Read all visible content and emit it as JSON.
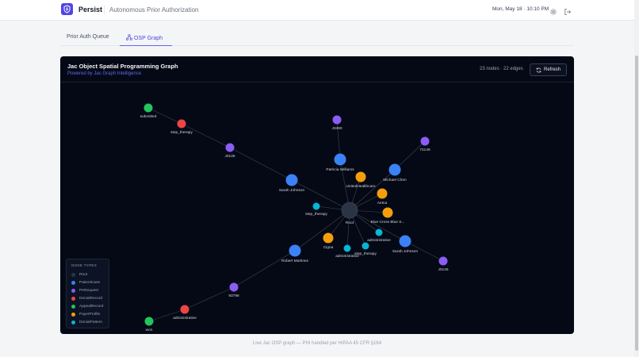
{
  "header": {
    "brand": "Persist",
    "subtitle": "Autonomous Prior Authorization",
    "datetime": "Mon, May 18 · 10:10 PM",
    "icons": [
      "shield-logo-icon",
      "gear-icon",
      "logout-icon"
    ]
  },
  "tabs": [
    {
      "label": "Prior Auth Queue",
      "active": false
    },
    {
      "label": "OSP Graph",
      "active": true,
      "icon": "graph-icon"
    }
  ],
  "panel": {
    "title": "Jac Object Spatial Programming Graph",
    "subtitle": "Powered by Jac Graph Intelligence",
    "stats": "23 nodes · 22 edges",
    "refresh_label": "Refresh"
  },
  "legend": {
    "title": "NODE TYPES",
    "items": [
      {
        "label": "Root",
        "color": "#2b3445"
      },
      {
        "label": "PatientCase",
        "color": "#3b82f6"
      },
      {
        "label": "PARequest",
        "color": "#8b5cf6"
      },
      {
        "label": "DenialRecord",
        "color": "#ef4444"
      },
      {
        "label": "AppealRecord",
        "color": "#22c55e"
      },
      {
        "label": "PayerProfile",
        "color": "#f59e0b"
      },
      {
        "label": "DenialPattern",
        "color": "#06b6d4"
      }
    ]
  },
  "graph": {
    "nodes": [
      {
        "id": "root",
        "label": "Root",
        "type": "Root"
      },
      {
        "id": "n1",
        "label": "submitted",
        "type": "AppealRecord"
      },
      {
        "id": "n2",
        "label": "step_therapy",
        "type": "DenialRecord"
      },
      {
        "id": "n3",
        "label": "J0135",
        "type": "PARequest"
      },
      {
        "id": "n4",
        "label": "Sarah Johnson",
        "type": "PatientCase"
      },
      {
        "id": "n5",
        "label": "J3490",
        "type": "PARequest"
      },
      {
        "id": "n6",
        "label": "Patricia Williams",
        "type": "PatientCase"
      },
      {
        "id": "n7",
        "label": "UnitedHealthcare",
        "type": "PayerProfile"
      },
      {
        "id": "n8",
        "label": "72148",
        "type": "PARequest"
      },
      {
        "id": "n9",
        "label": "Michael Chen",
        "type": "PatientCase"
      },
      {
        "id": "n10",
        "label": "Aetna",
        "type": "PayerProfile"
      },
      {
        "id": "n11",
        "label": "step_therapy",
        "type": "DenialPattern"
      },
      {
        "id": "n12",
        "label": "Blue Cross Blue S...",
        "type": "PayerProfile"
      },
      {
        "id": "n13",
        "label": "administrative",
        "type": "DenialPattern"
      },
      {
        "id": "n14",
        "label": "Sarah Johnson",
        "type": "PatientCase"
      },
      {
        "id": "n15",
        "label": "J0135",
        "type": "PARequest"
      },
      {
        "id": "n16",
        "label": "Cigna",
        "type": "PayerProfile"
      },
      {
        "id": "n17",
        "label": "administrative",
        "type": "DenialPattern"
      },
      {
        "id": "n18",
        "label": "step_therapy",
        "type": "DenialPattern"
      },
      {
        "id": "n19",
        "label": "Robert Martinez",
        "type": "PatientCase"
      },
      {
        "id": "n20",
        "label": "93798",
        "type": "PARequest"
      },
      {
        "id": "n21",
        "label": "administrative",
        "type": "DenialRecord"
      },
      {
        "id": "n22",
        "label": "won",
        "type": "AppealRecord"
      }
    ],
    "edges": [
      [
        "n1",
        "n2"
      ],
      [
        "n2",
        "n3"
      ],
      [
        "n3",
        "n4"
      ],
      [
        "n4",
        "root"
      ],
      [
        "n5",
        "n6"
      ],
      [
        "n6",
        "root"
      ],
      [
        "n8",
        "n9"
      ],
      [
        "n9",
        "root"
      ],
      [
        "n7",
        "root"
      ],
      [
        "n10",
        "root"
      ],
      [
        "n11",
        "root"
      ],
      [
        "n12",
        "root"
      ],
      [
        "n13",
        "root"
      ],
      [
        "n14",
        "root"
      ],
      [
        "n14",
        "n15"
      ],
      [
        "n16",
        "root"
      ],
      [
        "n17",
        "root"
      ],
      [
        "n18",
        "root"
      ],
      [
        "n19",
        "root"
      ],
      [
        "n19",
        "n20"
      ],
      [
        "n20",
        "n21"
      ],
      [
        "n21",
        "n22"
      ]
    ]
  },
  "footer": "Live Jac OSP graph — PHI handled per HIPAA 45 CFR §164"
}
